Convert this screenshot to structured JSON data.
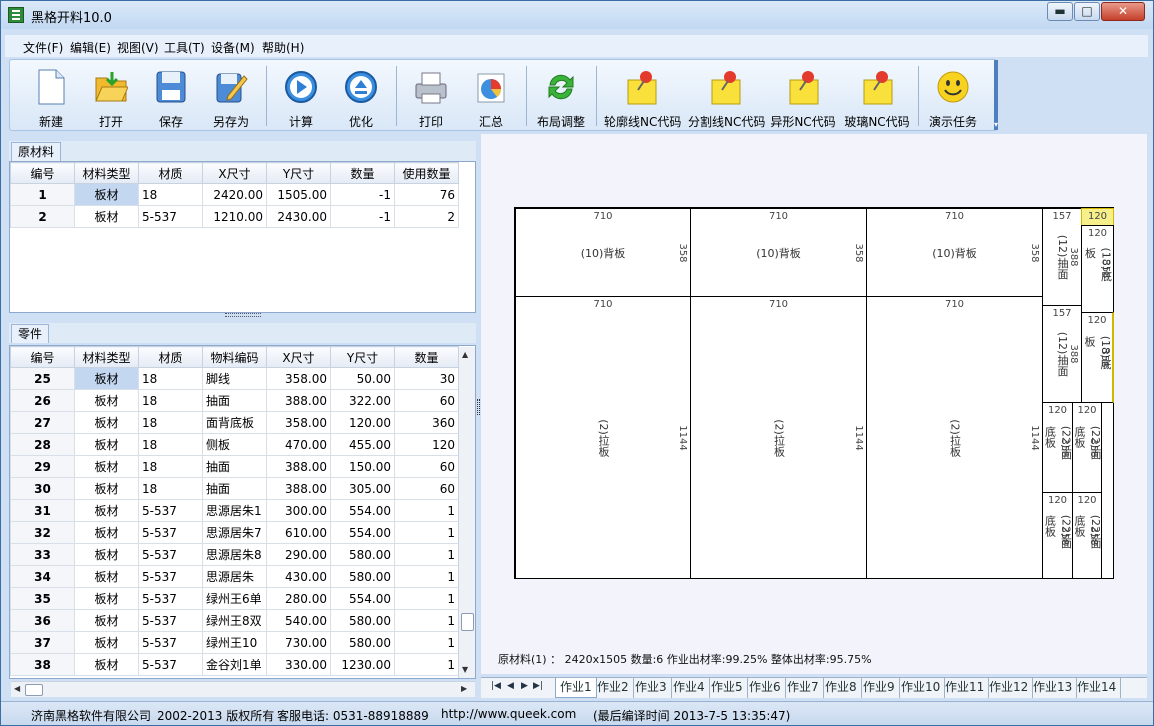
{
  "window": {
    "title": "黑格开料10.0",
    "min": "▬",
    "max": "□",
    "close": "✕"
  },
  "menu": [
    "文件(F)",
    "编辑(E)",
    "视图(V)",
    "工具(T)",
    "设备(M)",
    "帮助(H)"
  ],
  "toolbar": [
    {
      "label": "新建",
      "icon": "new-file-icon"
    },
    {
      "label": "打开",
      "icon": "open-folder-icon"
    },
    {
      "label": "保存",
      "icon": "save-disk-icon"
    },
    {
      "label": "另存为",
      "icon": "save-as-icon"
    },
    {
      "label": "计算",
      "icon": "play-icon"
    },
    {
      "label": "优化",
      "icon": "eject-icon"
    },
    {
      "label": "打印",
      "icon": "printer-icon"
    },
    {
      "label": "汇总",
      "icon": "pie-chart-icon"
    },
    {
      "label": "布局调整",
      "icon": "refresh-arrows-icon"
    },
    {
      "label": "轮廓线NC代码",
      "icon": "pin-note-icon"
    },
    {
      "label": "分割线NC代码",
      "icon": "pin-note-icon"
    },
    {
      "label": "异形NC代码",
      "icon": "pin-note-icon"
    },
    {
      "label": "玻璃NC代码",
      "icon": "pin-note-icon"
    },
    {
      "label": "演示任务",
      "icon": "smiley-icon"
    }
  ],
  "raw": {
    "tab": "原材料",
    "headers": [
      "编号",
      "材料类型",
      "材质",
      "X尺寸",
      "Y尺寸",
      "数量",
      "使用数量"
    ],
    "rows": [
      [
        "1",
        "板材",
        "18",
        "2420.00",
        "1505.00",
        "-1",
        "76"
      ],
      [
        "2",
        "板材",
        "5-537",
        "1210.00",
        "2430.00",
        "-1",
        "2"
      ]
    ]
  },
  "parts": {
    "tab": "零件",
    "headers": [
      "编号",
      "材料类型",
      "材质",
      "物料编码",
      "X尺寸",
      "Y尺寸",
      "数量"
    ],
    "rows": [
      [
        "25",
        "板材",
        "18",
        "脚线",
        "358.00",
        "50.00",
        "30"
      ],
      [
        "26",
        "板材",
        "18",
        "抽面",
        "388.00",
        "322.00",
        "60"
      ],
      [
        "27",
        "板材",
        "18",
        "面背底板",
        "358.00",
        "120.00",
        "360"
      ],
      [
        "28",
        "板材",
        "18",
        "侧板",
        "470.00",
        "455.00",
        "120"
      ],
      [
        "29",
        "板材",
        "18",
        "抽面",
        "388.00",
        "150.00",
        "60"
      ],
      [
        "30",
        "板材",
        "18",
        "抽面",
        "388.00",
        "305.00",
        "60"
      ],
      [
        "31",
        "板材",
        "5-537",
        "思源居朱1",
        "300.00",
        "554.00",
        "1"
      ],
      [
        "32",
        "板材",
        "5-537",
        "思源居朱7",
        "610.00",
        "554.00",
        "1"
      ],
      [
        "33",
        "板材",
        "5-537",
        "思源居朱8",
        "290.00",
        "580.00",
        "1"
      ],
      [
        "34",
        "板材",
        "5-537",
        "思源居朱",
        "430.00",
        "580.00",
        "1"
      ],
      [
        "35",
        "板材",
        "5-537",
        "绿州王6单",
        "280.00",
        "554.00",
        "1"
      ],
      [
        "36",
        "板材",
        "5-537",
        "绿州王8双",
        "540.00",
        "580.00",
        "1"
      ],
      [
        "37",
        "板材",
        "5-537",
        "绿州王10",
        "730.00",
        "580.00",
        "1"
      ],
      [
        "38",
        "板材",
        "5-537",
        "金谷刘1单",
        "330.00",
        "1230.00",
        "1"
      ]
    ]
  },
  "layout": {
    "top_width": "710",
    "top_height": "358",
    "top_label": "(10)背板",
    "big_width": "710",
    "big_height": "1144",
    "big_label": "(2)拉板",
    "drawer_width": "157",
    "drawer_height": "388",
    "drawer_label": "(12)抽面",
    "bottom_width": "120",
    "bottom_height": "358",
    "bottom_label": "(18)底板",
    "bottom2_label": "(22)面底板",
    "info": "原材料(1) ： 2420x1505   数量:6   作业出材率:99.25%   整体出材率:95.75%"
  },
  "sheets": [
    "作业1",
    "作业2",
    "作业3",
    "作业4",
    "作业5",
    "作业6",
    "作业7",
    "作业8",
    "作业9",
    "作业10",
    "作业11",
    "作业12",
    "作业13",
    "作业14"
  ],
  "status": {
    "company": "济南黑格软件有限公司",
    "copyright": "2002-2013 版权所有",
    "phone": "客服电话: 0531-88918889",
    "url": "http://www.queek.com",
    "build": "(最后编译时间 2013-7-5 13:35:47)"
  }
}
